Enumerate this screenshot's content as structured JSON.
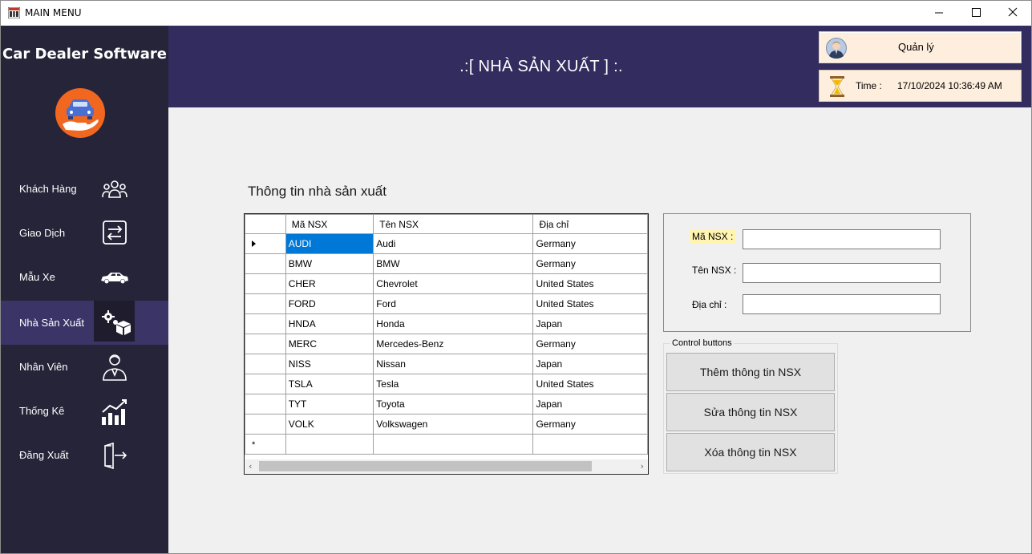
{
  "window": {
    "title": "MAIN MENU"
  },
  "sidebar": {
    "brand": "Car Dealer Software",
    "items": [
      {
        "label": "Khách Hàng",
        "icon": "customers-icon"
      },
      {
        "label": "Giao Dịch",
        "icon": "transaction-icon"
      },
      {
        "label": "Mẫu Xe",
        "icon": "car-icon"
      },
      {
        "label": "Nhà Sản Xuất",
        "icon": "manufacturer-icon",
        "active": true
      },
      {
        "label": "Nhân Viên",
        "icon": "employee-icon"
      },
      {
        "label": "Thống Kê",
        "icon": "statistics-icon"
      },
      {
        "label": "Đăng Xuất",
        "icon": "logout-icon"
      }
    ]
  },
  "header": {
    "title": ".:[ NHÀ SẢN XUẤT ] :.",
    "user_label": "Quản lý",
    "time_label": "Time :",
    "time_value": "17/10/2024 10:36:49 AM"
  },
  "content": {
    "section_title": "Thông tin nhà sản xuất",
    "grid": {
      "columns": [
        "Mã NSX",
        "Tên NSX",
        "Địa chỉ"
      ],
      "rows": [
        [
          "AUDI",
          "Audi",
          "Germany"
        ],
        [
          "BMW",
          "BMW",
          "Germany"
        ],
        [
          "CHER",
          "Chevrolet",
          "United States"
        ],
        [
          "FORD",
          "Ford",
          "United States"
        ],
        [
          "HNDA",
          "Honda",
          "Japan"
        ],
        [
          "MERC",
          "Mercedes-Benz",
          "Germany"
        ],
        [
          "NISS",
          "Nissan",
          "Japan"
        ],
        [
          "TSLA",
          "Tesla",
          "United States"
        ],
        [
          "TYT",
          "Toyota",
          "Japan"
        ],
        [
          "VOLK",
          "Volkswagen",
          "Germany"
        ]
      ],
      "new_row_marker": "*"
    },
    "form": {
      "ma_label": "Mã NSX :",
      "ten_label": "Tên NSX :",
      "diachi_label": "Địa chỉ :",
      "ma_value": "",
      "ten_value": "",
      "diachi_value": ""
    },
    "controls": {
      "group_title": "Control buttons",
      "add_label": "Thêm thông tin NSX",
      "edit_label": "Sửa thông tin NSX",
      "delete_label": "Xóa thông tin NSX"
    }
  },
  "colors": {
    "sidebar_bg": "#262438",
    "sidebar_active": "#3a3566",
    "header_bg": "#332c5e",
    "selection": "#0078d7",
    "info_box": "#fdeedd",
    "highlight_label": "#fff4b0"
  }
}
